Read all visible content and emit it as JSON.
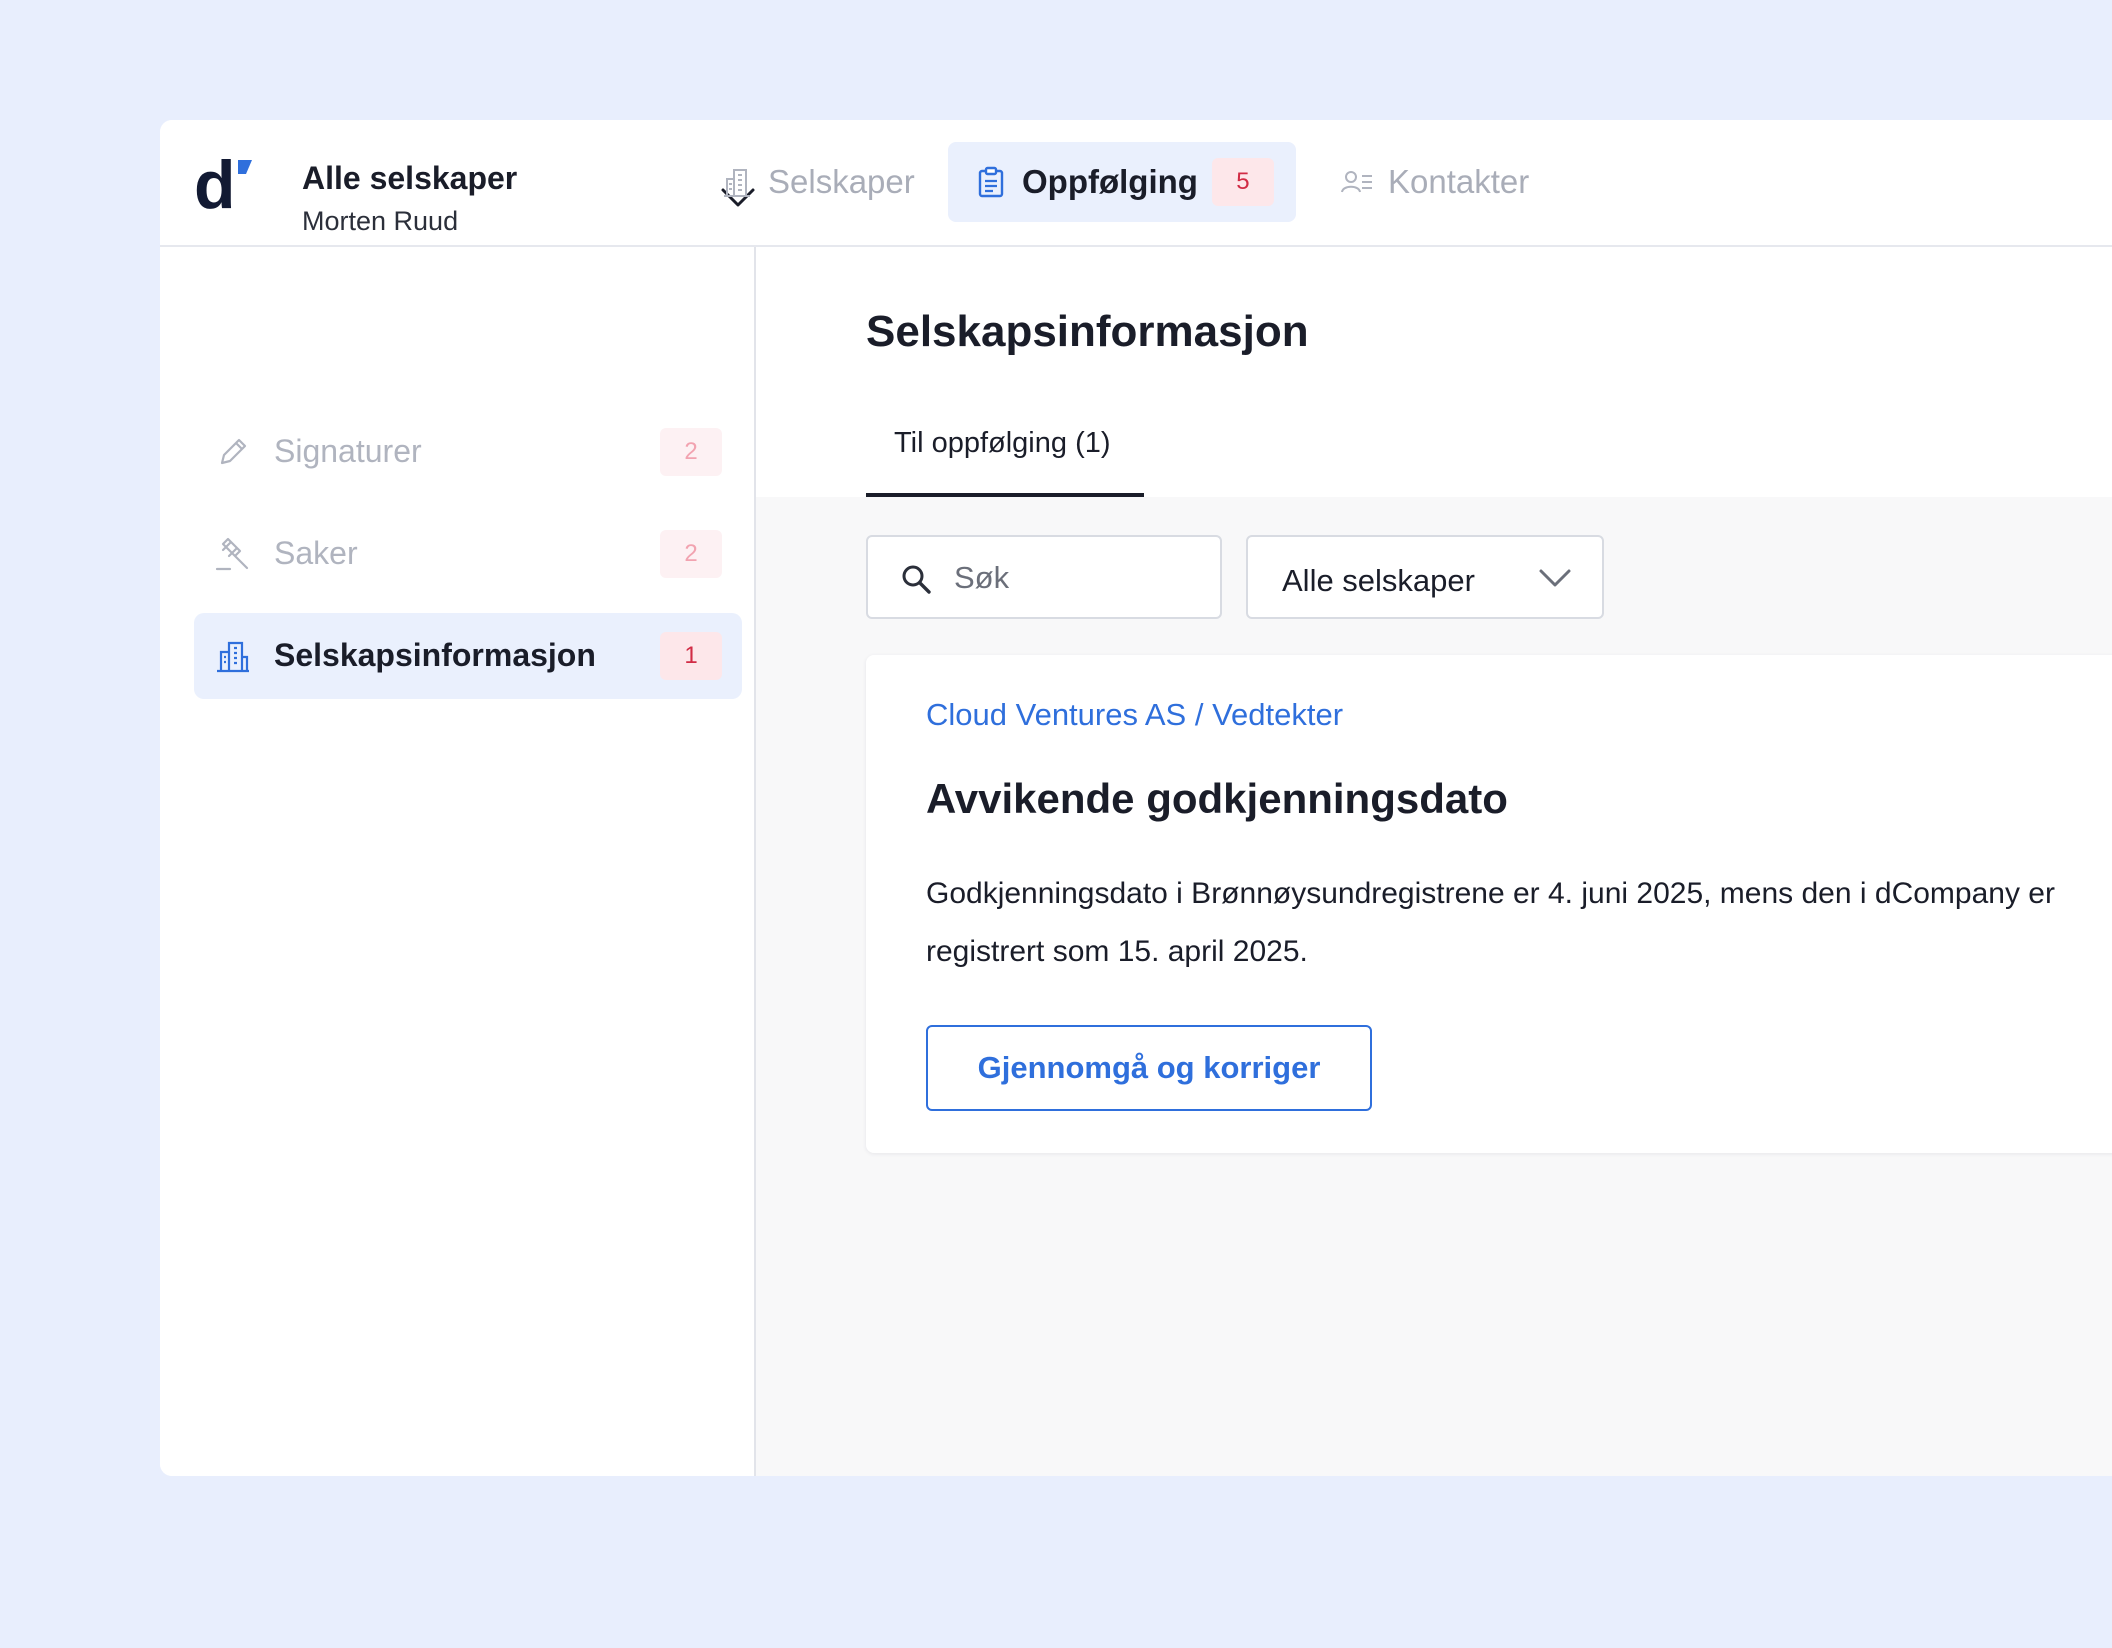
{
  "header": {
    "company_title": "Alle selskaper",
    "user_name": "Morten Ruud",
    "tabs": [
      {
        "label": "Selskaper",
        "icon": "building-icon"
      },
      {
        "label": "Oppfølging",
        "icon": "clipboard-icon",
        "badge": "5"
      },
      {
        "label": "Kontakter",
        "icon": "contacts-icon"
      }
    ]
  },
  "sidebar": {
    "items": [
      {
        "label": "Signaturer",
        "badge": "2",
        "icon": "pen-icon"
      },
      {
        "label": "Saker",
        "badge": "2",
        "icon": "gavel-icon"
      },
      {
        "label": "Selskapsinformasjon",
        "badge": "1",
        "icon": "building-icon"
      }
    ]
  },
  "main": {
    "title": "Selskapsinformasjon",
    "subtab": "Til oppfølging (1)",
    "search_placeholder": "Søk",
    "filter_value": "Alle selskaper",
    "card": {
      "link": "Cloud Ventures AS / Vedtekter",
      "title": "Avvikende godkjenningsdato",
      "text": "Godkjenningsdato i Brønnøysundregistrene er 4. juni 2025, mens den i dCompany er registrert som 15. april 2025.",
      "button": "Gjennomgå og korriger"
    }
  },
  "colors": {
    "page_bg": "#e8eefd",
    "accent": "#2f6fdc",
    "active_bg": "#eaf0fd",
    "badge_bg": "#fde7ea",
    "badge_text": "#d12c45"
  }
}
